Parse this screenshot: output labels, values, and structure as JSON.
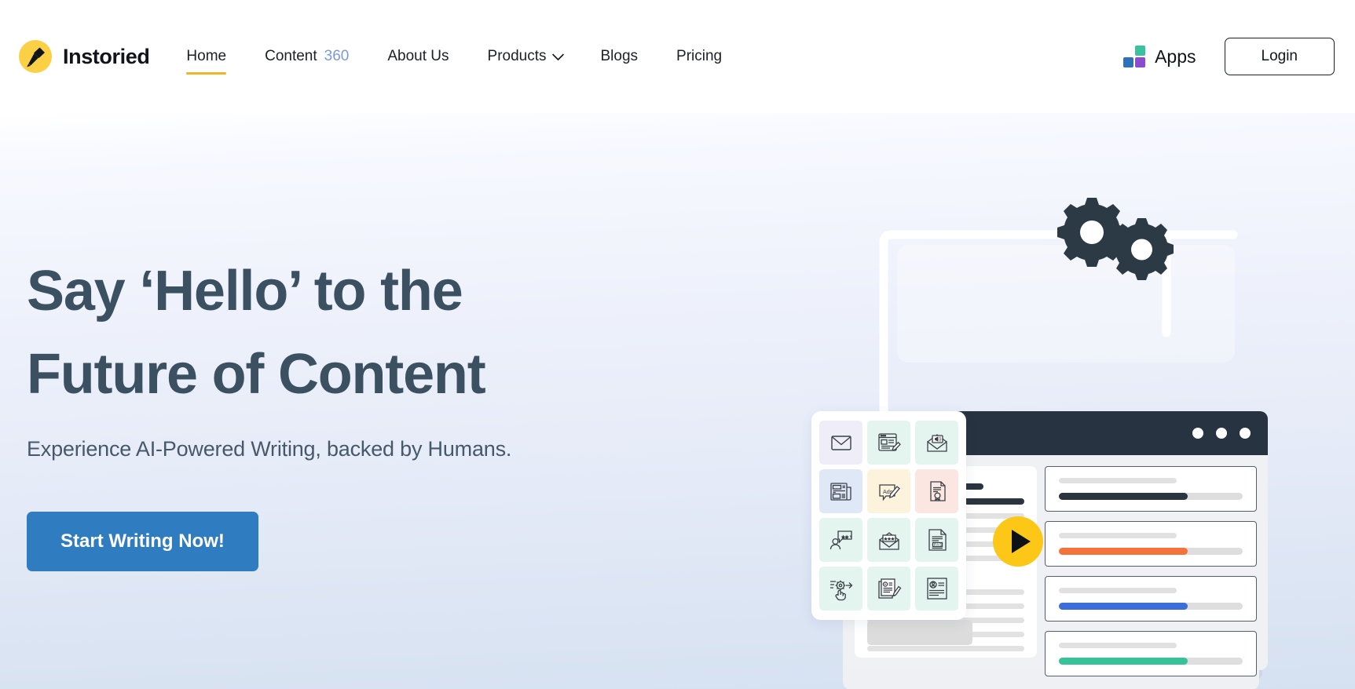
{
  "brand": {
    "name": "Instoried",
    "logo_icon": "pen-nib-icon",
    "logo_bg": "#fcd045"
  },
  "nav": {
    "items": [
      {
        "label": "Home",
        "suffix": "",
        "active": true,
        "has_caret": false
      },
      {
        "label": "Content",
        "suffix": "360",
        "active": false,
        "has_caret": false
      },
      {
        "label": "About Us",
        "suffix": "",
        "active": false,
        "has_caret": false
      },
      {
        "label": "Products",
        "suffix": "",
        "active": false,
        "has_caret": true
      },
      {
        "label": "Blogs",
        "suffix": "",
        "active": false,
        "has_caret": false
      },
      {
        "label": "Pricing",
        "suffix": "",
        "active": false,
        "has_caret": false
      }
    ],
    "active_underline_color": "#f0b429",
    "suffix_color": "#7a9ae6"
  },
  "header_right": {
    "apps_label": "Apps",
    "apps_icon": "apps-grid-icon",
    "apps_colors": {
      "green": "#3ac1a0",
      "blue": "#2f71b8",
      "purple": "#8b4ad1"
    },
    "login_label": "Login"
  },
  "hero": {
    "title_line1": "Say ‘Hello’ to the",
    "title_line2": "Future of Content",
    "title_color": "#3b5162",
    "subtitle": "Experience AI-Powered Writing, backed by Humans.",
    "cta_label": "Start Writing Now!",
    "cta_color": "#2f7cc0",
    "bg_gradient_from": "#ffffff",
    "bg_gradient_to": "#d5e1f1"
  },
  "illustration": {
    "gear_color": "#2b3a45",
    "window_bar_color": "#273340",
    "window_dots": 3,
    "play_button_color": "#fcc717",
    "play_icon": "play-triangle-icon",
    "icon_grid": [
      {
        "icon": "envelope-icon",
        "bg": "#efedf7"
      },
      {
        "icon": "blog-edit-icon",
        "bg": "#e3f5ee"
      },
      {
        "icon": "email-megaphone-icon",
        "bg": "#e3f5ee"
      },
      {
        "icon": "press-release-icon",
        "bg": "#dfe8f7",
        "label": "PRESS"
      },
      {
        "icon": "ads-copy-icon",
        "bg": "#fdf3dd",
        "label": "Ads"
      },
      {
        "icon": "certificate-doc-icon",
        "bg": "#fbe6e2"
      },
      {
        "icon": "review-rating-icon",
        "bg": "#e3f5ee"
      },
      {
        "icon": "email-rating-icon",
        "bg": "#e3f5ee"
      },
      {
        "icon": "pas-doc-icon",
        "bg": "#e3f5ee",
        "label": "PAS"
      },
      {
        "icon": "workflow-click-icon",
        "bg": "#e3f5ee"
      },
      {
        "icon": "article-write-icon",
        "bg": "#e3f5ee"
      },
      {
        "icon": "profile-doc-icon",
        "bg": "#e3f5ee"
      }
    ],
    "stat_cards": [
      {
        "name": "stat-dark",
        "fill_color": "#2a3540",
        "percent": 70
      },
      {
        "name": "stat-orange",
        "fill_color": "#f4733a",
        "percent": 70
      },
      {
        "name": "stat-blue",
        "fill_color": "#3b6ed8",
        "percent": 70
      },
      {
        "name": "stat-green",
        "fill_color": "#38c29a",
        "percent": 70
      }
    ]
  }
}
